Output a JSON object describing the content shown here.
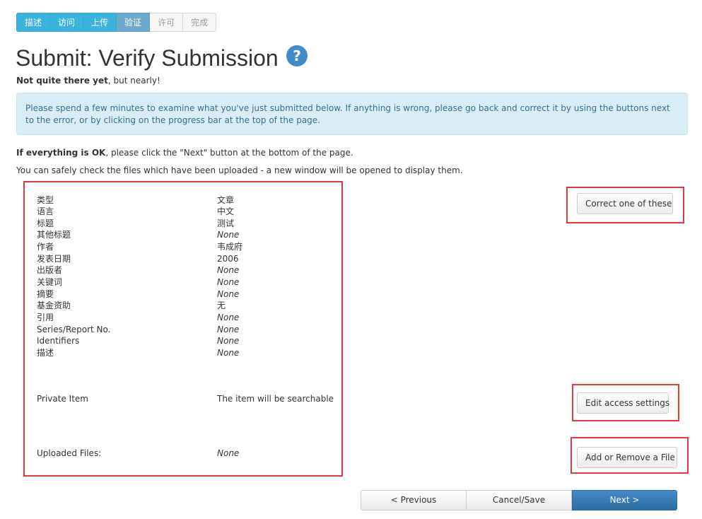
{
  "progress": {
    "steps": [
      {
        "label": "描述",
        "state": "done"
      },
      {
        "label": "访问",
        "state": "done"
      },
      {
        "label": "上传",
        "state": "done"
      },
      {
        "label": "验证",
        "state": "current"
      },
      {
        "label": "许可",
        "state": "pending"
      },
      {
        "label": "完成",
        "state": "pending"
      }
    ]
  },
  "page": {
    "title": "Submit: Verify Submission",
    "help_icon": "question-circle-icon",
    "subtitle_bold": "Not quite there yet",
    "subtitle_rest": ", but nearly!",
    "alert": "Please spend a few minutes to examine what you've just submitted below. If anything is wrong, please go back and correct it by using the buttons next to the error, or by clicking on the progress bar at the top of the page.",
    "ok_bold": "If everything is OK",
    "ok_rest": ", please click the \"Next\" button at the bottom of the page.",
    "files_note": "You can safely check the files which have been uploaded - a new window will be opened to display them."
  },
  "review": {
    "metadata": [
      {
        "label": "类型",
        "value": "文章",
        "none": false
      },
      {
        "label": "语言",
        "value": "中文",
        "none": false
      },
      {
        "label": "标题",
        "value": "测试",
        "none": false
      },
      {
        "label": "其他标题",
        "value": "None",
        "none": true
      },
      {
        "label": "作者",
        "value": "韦成府",
        "none": false
      },
      {
        "label": "发表日期",
        "value": "2006",
        "none": false
      },
      {
        "label": "出版者",
        "value": "None",
        "none": true
      },
      {
        "label": "关键词",
        "value": "None",
        "none": true
      },
      {
        "label": "摘要",
        "value": "None",
        "none": true
      },
      {
        "label": "基金资助",
        "value": "无",
        "none": false
      },
      {
        "label": "引用",
        "value": "None",
        "none": true
      },
      {
        "label": "Series/Report No.",
        "value": "None",
        "none": true
      },
      {
        "label": "Identifiers",
        "value": "None",
        "none": true
      },
      {
        "label": "描述",
        "value": "None",
        "none": true
      }
    ],
    "access": {
      "label": "Private Item",
      "value": "The item will be searchable"
    },
    "files": {
      "label": "Uploaded Files:",
      "value": "None"
    }
  },
  "actions": {
    "correct": "Correct one of these",
    "edit_access": "Edit access settings",
    "add_remove_file": "Add or Remove a File",
    "previous": "< Previous",
    "cancel_save": "Cancel/Save",
    "next": "Next >"
  },
  "colors": {
    "step_done": "#3ab4de",
    "step_current": "#6ba9cf",
    "alert_bg": "#d9edf7",
    "alert_text": "#31708f",
    "highlight": "#e03a3e",
    "primary": "#428bca"
  }
}
